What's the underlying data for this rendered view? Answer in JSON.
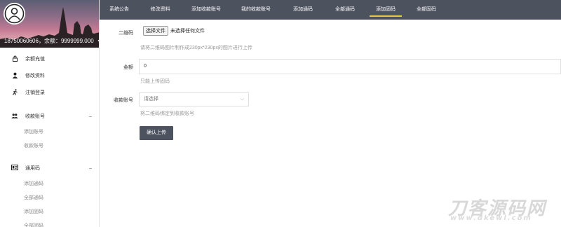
{
  "user": {
    "account_line": "18750060606，余额：9999999.000",
    "menu_caret": "▾"
  },
  "sidebar": {
    "items": [
      {
        "label": "余额充值",
        "icon": "lock-icon",
        "glyph": "🔒"
      },
      {
        "label": "修改资料",
        "icon": "user-icon",
        "glyph": "👤"
      },
      {
        "label": "注销登录",
        "icon": "running-person-icon",
        "glyph": "🏃"
      }
    ],
    "groups": [
      {
        "label": "收款账号",
        "icon": "people-icon",
        "glyph": "👥",
        "toggle": "–",
        "children": [
          "添加账号",
          "收款账号"
        ]
      },
      {
        "label": "通用码",
        "icon": "id-card-icon",
        "glyph": "🪪",
        "toggle": "–",
        "children": [
          "添加通码",
          "全部通码",
          "添加固码",
          "全部固码"
        ]
      }
    ]
  },
  "tabs": [
    {
      "label": "系统公告",
      "active": false
    },
    {
      "label": "修改资料",
      "active": false
    },
    {
      "label": "添加收款账号",
      "active": false
    },
    {
      "label": "我的收款账号",
      "active": false
    },
    {
      "label": "添加通码",
      "active": false
    },
    {
      "label": "全部通码",
      "active": false
    },
    {
      "label": "添加固码",
      "active": true
    },
    {
      "label": "全部固码",
      "active": false
    }
  ],
  "form": {
    "qrcode_label": "二维码",
    "file_button": "选择文件",
    "file_status": "未选择任何文件",
    "qrcode_help": "请将二维码图片制作成230px*230px的图片进行上传",
    "amount_label": "金额",
    "amount_value": "0",
    "amount_help": "只能上传固码",
    "account_label": "收款账号",
    "account_select_value": "请选择",
    "account_help": "将二维码绑定到收款账号",
    "submit_label": "确认上传"
  },
  "watermark": {
    "title": "刀客源码网",
    "url": "www.dkewl.com"
  },
  "colors": {
    "topbar_bg": "#4d525f",
    "active_underline": "#e8c846",
    "button_bg": "#4d525f",
    "help_text": "#999999"
  }
}
